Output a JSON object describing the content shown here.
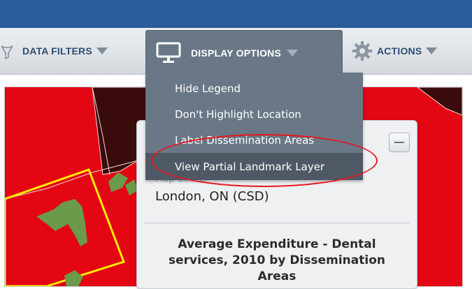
{
  "toolbar": {
    "data_filters_label": "DATA FILTERS",
    "display_options_label": "DISPLAY OPTIONS",
    "actions_label": "ACTIONS"
  },
  "display_options_menu": {
    "items": [
      {
        "label": "Hide Legend"
      },
      {
        "label": "Don't Highlight Location"
      },
      {
        "label": "Label Dissemination Areas"
      },
      {
        "label": "View Partial Landmark Layer",
        "highlighted": true
      }
    ]
  },
  "info_panel": {
    "sub_label": "Map Center",
    "place": "London, ON (CSD)",
    "title": "Average Expenditure - Dental services, 2010 by Dissemination Areas"
  },
  "colors": {
    "top_bar": "#2b5c9c",
    "menu_bg": "#697786",
    "map_fill": "#e30613",
    "landmark": "#6a9a4a",
    "highlight_boundary": "#ffee00",
    "annotation": "#e8161d"
  },
  "icons": {
    "filters": "funnel-icon",
    "display": "monitor-icon",
    "actions": "gear-icon",
    "dropdown": "triangle-down-icon"
  }
}
